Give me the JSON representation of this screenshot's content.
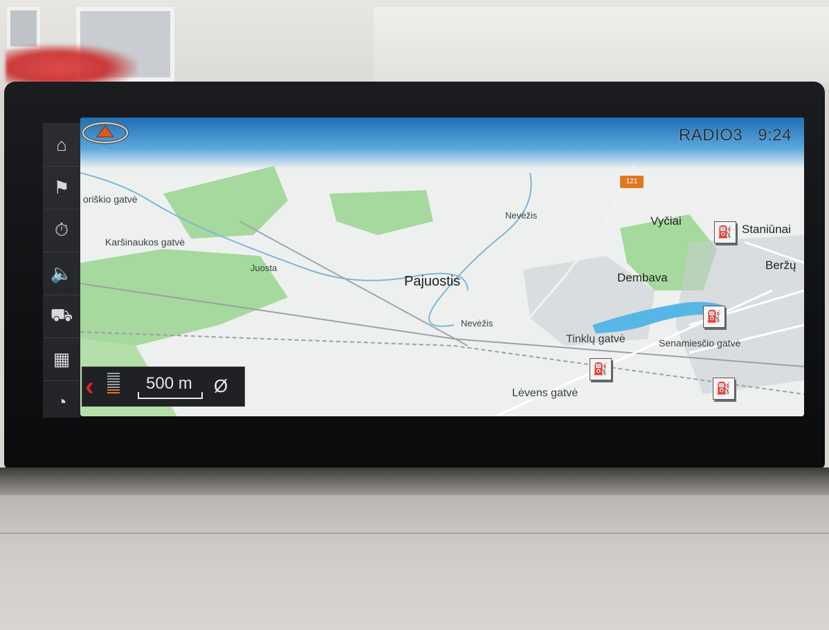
{
  "status": {
    "source": "RADIO3",
    "time": "9:24"
  },
  "road_badge": "121",
  "map_labels": {
    "street_top_left": "oriškio gatvė",
    "street_karsinaukos": "Karšinaukos gatvė",
    "river_juosta": "Juosta",
    "river_nevezis_top": "Nevėžis",
    "river_nevezis_center": "Nevėžis",
    "town_pajuostis": "Pajuostis",
    "town_dembava": "Dembava",
    "town_vyciai": "Vyčiai",
    "town_staniunai": "Staniūnai",
    "town_berzu": "Beržų",
    "street_tinklu": "Tinklų gatvė",
    "street_senamiescio": "Senamiesčio gatvė",
    "street_levens": "Lėvens gatvė"
  },
  "scale": {
    "value": "500 m",
    "zoom_level": 2,
    "zoom_steps": 8
  },
  "menu": {
    "items": [
      "home-icon",
      "destination-flag-icon",
      "timer-icon",
      "speaker-icon",
      "traffic-icon",
      "map-icon",
      "compass-icon"
    ]
  },
  "colors": {
    "map_background": "#eef0f0",
    "forest": "#9fd69a",
    "water": "#56b7e6",
    "accent": "#e07820",
    "menu_background": "#2b2d31"
  }
}
